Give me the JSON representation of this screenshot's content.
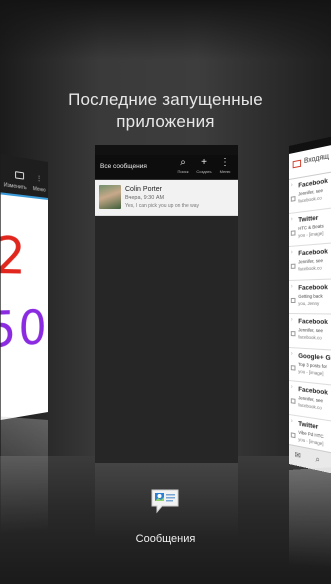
{
  "header": {
    "title_line1": "Последние запущенные",
    "title_line2": "приложения"
  },
  "cards": {
    "left": {
      "toolbar_left_label": "Изменить",
      "toolbar_right_label": "Меню",
      "drawing_digit_top": "2",
      "drawing_digits_bottom": "50"
    },
    "center": {
      "app_title": "Все сообщения",
      "actions": [
        {
          "icon": "search-icon",
          "label": "Поиск"
        },
        {
          "icon": "plus-icon",
          "label": "Создать"
        },
        {
          "icon": "menu-icon",
          "label": "Меню"
        }
      ],
      "message": {
        "name": "Colin Porter",
        "time": "Вчера, 9:30 AM",
        "snippet": "Yes, I can pick you up on the way"
      },
      "app_label": "Сообщения"
    },
    "right": {
      "app_title": "Входящ",
      "subtitle": "",
      "rows": [
        {
          "sender": "Facebook",
          "line1": "Jennifer, see",
          "line2": "facebook.co"
        },
        {
          "sender": "Twitter",
          "line1": "HTC & Beats",
          "line2": "you - [image]"
        },
        {
          "sender": "Facebook",
          "line1": "Jennifer, see",
          "line2": "facebook.co"
        },
        {
          "sender": "Facebook",
          "line1": "Getting back",
          "line2": "you, Jenny"
        },
        {
          "sender": "Facebook",
          "line1": "Jennifer, see",
          "line2": "facebook.co"
        },
        {
          "sender": "Google+ Gle",
          "line1": "Top 3 posts for",
          "line2": "you - [image]"
        },
        {
          "sender": "Facebook",
          "line1": "Jennifer, see",
          "line2": "facebook.co"
        },
        {
          "sender": "Twitter",
          "line1": "Vibe Pd HTC",
          "line2": "you - [image]"
        },
        {
          "sender": "Facebook",
          "line1": "",
          "line2": ""
        }
      ]
    }
  },
  "colors": {
    "accent_blue": "#3a9ad9",
    "gmail_red": "#d23a2a",
    "drawing_red": "#e0261d",
    "drawing_purple": "#8a2be2"
  }
}
